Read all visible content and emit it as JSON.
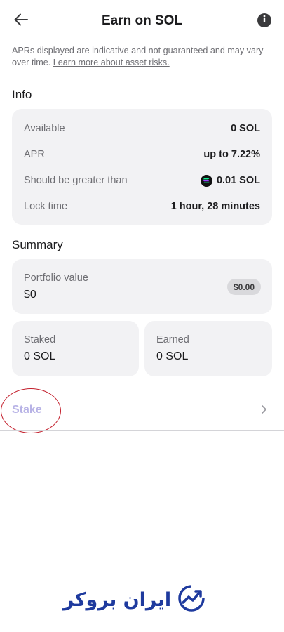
{
  "header": {
    "title": "Earn on SOL",
    "back_icon": "arrow-left-icon",
    "info_icon": "info-circle-icon"
  },
  "disclaimer": {
    "text": "APRs displayed are indicative and not guaranteed and may vary over time.",
    "link": "Learn more about asset risks."
  },
  "info": {
    "title": "Info",
    "rows": [
      {
        "label": "Available",
        "value": "0 SOL"
      },
      {
        "label": "APR",
        "value": "up to 7.22%"
      },
      {
        "label": "Should be greater than",
        "value": "0.01 SOL",
        "icon": "sol-coin-icon"
      },
      {
        "label": "Lock time",
        "value": "1 hour, 28 minutes"
      }
    ]
  },
  "summary": {
    "title": "Summary",
    "portfolio": {
      "label": "Portfolio value",
      "value": "$0",
      "badge": "$0.00"
    },
    "staked": {
      "label": "Staked",
      "value": "0 SOL"
    },
    "earned": {
      "label": "Earned",
      "value": "0 SOL"
    }
  },
  "action": {
    "label": "Stake",
    "chevron_icon": "chevron-right-icon"
  },
  "watermark": {
    "text": "ایران بروکر"
  },
  "colors": {
    "card_bg": "#f2f2f4",
    "stake_disabled": "#b8b3e6",
    "highlight_circle": "#c4212e",
    "watermark_blue": "#1e3a9e"
  }
}
